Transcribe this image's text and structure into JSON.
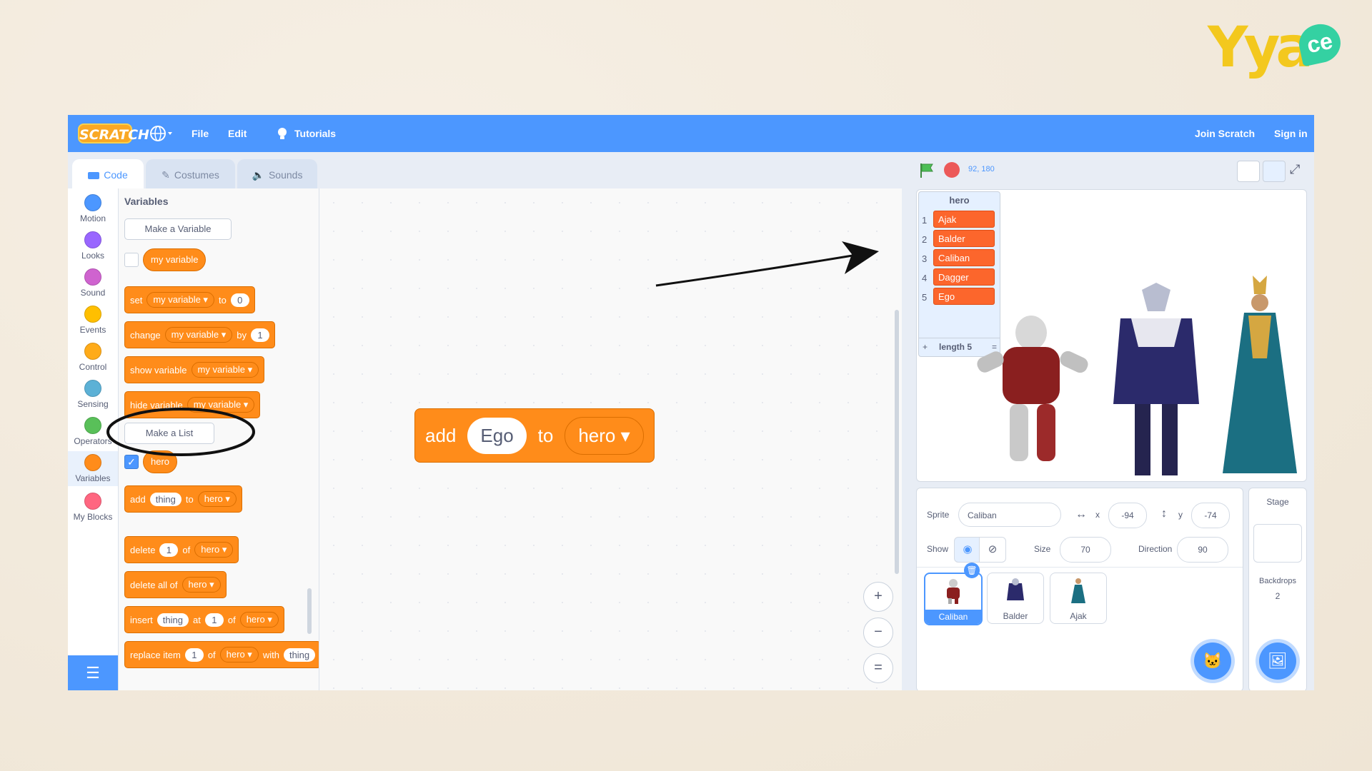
{
  "brand": {
    "main": "Yya",
    "badge": "ce"
  },
  "menubar": {
    "logo": "SCRATCH",
    "file": "File",
    "edit": "Edit",
    "tutorials": "Tutorials",
    "join": "Join Scratch",
    "sign_in": "Sign in"
  },
  "tabs": {
    "code": "Code",
    "costumes": "Costumes",
    "sounds": "Sounds"
  },
  "categories": [
    {
      "label": "Motion",
      "color": "#4c97ff"
    },
    {
      "label": "Looks",
      "color": "#9966ff"
    },
    {
      "label": "Sound",
      "color": "#cf63cf"
    },
    {
      "label": "Events",
      "color": "#ffbf00"
    },
    {
      "label": "Control",
      "color": "#ffab19"
    },
    {
      "label": "Sensing",
      "color": "#5cb1d6"
    },
    {
      "label": "Operators",
      "color": "#59c059"
    },
    {
      "label": "Variables",
      "color": "#ff8c1a"
    },
    {
      "label": "My Blocks",
      "color": "#ff6680"
    }
  ],
  "palette": {
    "heading": "Variables",
    "make_variable": "Make a Variable",
    "my_variable": "my variable",
    "set": {
      "op": "set",
      "var": "my variable",
      "to": "to",
      "val": "0"
    },
    "change": {
      "op": "change",
      "var": "my variable",
      "by": "by",
      "val": "1"
    },
    "show_var": {
      "op": "show variable",
      "var": "my variable"
    },
    "hide_var": {
      "op": "hide variable",
      "var": "my variable"
    },
    "make_list": "Make a List",
    "hero": "hero",
    "add": {
      "op": "add",
      "item": "thing",
      "to": "to",
      "list": "hero"
    },
    "delete": {
      "op": "delete",
      "idx": "1",
      "of": "of",
      "list": "hero"
    },
    "delete_all": {
      "op": "delete all of",
      "list": "hero"
    },
    "insert": {
      "op": "insert",
      "item": "thing",
      "at": "at",
      "idx": "1",
      "of": "of",
      "list": "hero"
    },
    "replace": {
      "op": "replace item",
      "idx": "1",
      "of": "of",
      "list": "hero",
      "with": "with",
      "item": "thing"
    }
  },
  "workspace_block": {
    "op": "add",
    "item": "Ego",
    "to": "to",
    "list": "hero"
  },
  "zoom": {
    "in": "+",
    "out": "−",
    "reset": "="
  },
  "stage": {
    "coords": "92, 180",
    "list_monitor": {
      "title": "hero",
      "items": [
        "Ajak",
        "Balder",
        "Caliban",
        "Dagger",
        "Ego"
      ],
      "indices": [
        "1",
        "2",
        "3",
        "4",
        "5"
      ],
      "add": "+",
      "length": "length 5",
      "resize": "="
    }
  },
  "sprite_info": {
    "sprite_label": "Sprite",
    "sprite_name": "Caliban",
    "x_label": "x",
    "x": "-94",
    "y_label": "y",
    "y": "-74",
    "show_label": "Show",
    "size_label": "Size",
    "size": "70",
    "direction_label": "Direction",
    "direction": "90",
    "sprites": [
      "Caliban",
      "Balder",
      "Ajak"
    ]
  },
  "stage_pane": {
    "title": "Stage",
    "backdrops_label": "Backdrops",
    "backdrops": "2"
  },
  "colors": {
    "accent": "#4c97ff",
    "variables": "#ff8c1a",
    "list_item": "#fc662c"
  }
}
